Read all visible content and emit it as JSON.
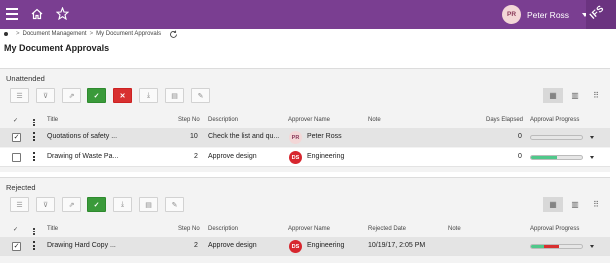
{
  "topbar": {
    "user_initials": "PR",
    "user_name": "Peter Ross",
    "logo_text": "IFS"
  },
  "breadcrumb": [
    "Document Management",
    "My Document Approvals"
  ],
  "page_title": "My Document Approvals",
  "colors": {
    "header": "#7a3e91",
    "green": "#3a9a3a",
    "red": "#d83030",
    "progress_green": "#4fc88a",
    "progress_red": "#d83030"
  },
  "unattended": {
    "title": "Unattended",
    "columns": {
      "check": "✓",
      "title": "Title",
      "step": "Step No",
      "desc": "Description",
      "approver": "Approver Name",
      "note": "Note",
      "days": "Days Elapsed",
      "progress": "Approval Progress"
    },
    "rows": [
      {
        "checked": "✓",
        "title": "Quotations of safety ...",
        "step": "10",
        "desc": "Check the list and qu...",
        "initials": "PR",
        "approver": "Peter Ross",
        "note": "",
        "days": "0",
        "progress": {
          "green": 0,
          "red": 0
        }
      },
      {
        "checked": "",
        "title": "Drawing of Waste Pa...",
        "step": "2",
        "desc": "Approve design",
        "initials": "DS",
        "approver": "Engineering",
        "note": "",
        "days": "0",
        "progress": {
          "green": 0.5,
          "red": 0
        }
      }
    ]
  },
  "rejected": {
    "title": "Rejected",
    "columns": {
      "check": "✓",
      "title": "Title",
      "step": "Step No",
      "desc": "Description",
      "approver": "Approver Name",
      "date": "Rejected Date",
      "note": "Note",
      "progress": "Approval Progress"
    },
    "rows": [
      {
        "checked": "✓",
        "title": "Drawing Hard Copy ...",
        "step": "2",
        "desc": "Approve design",
        "initials": "DS",
        "approver": "Engineering",
        "date": "10/19/17, 2:05 PM",
        "note": "",
        "progress": {
          "green": 0.25,
          "red": 0.3
        }
      }
    ]
  },
  "icons": [
    "menu-icon",
    "home-icon",
    "star-icon",
    "refresh-icon",
    "list-icon",
    "filter-icon",
    "export-icon",
    "check-icon",
    "close-icon",
    "download-icon",
    "document-icon",
    "edit-icon",
    "card-view-icon",
    "list-view-icon",
    "grid-view-icon"
  ]
}
